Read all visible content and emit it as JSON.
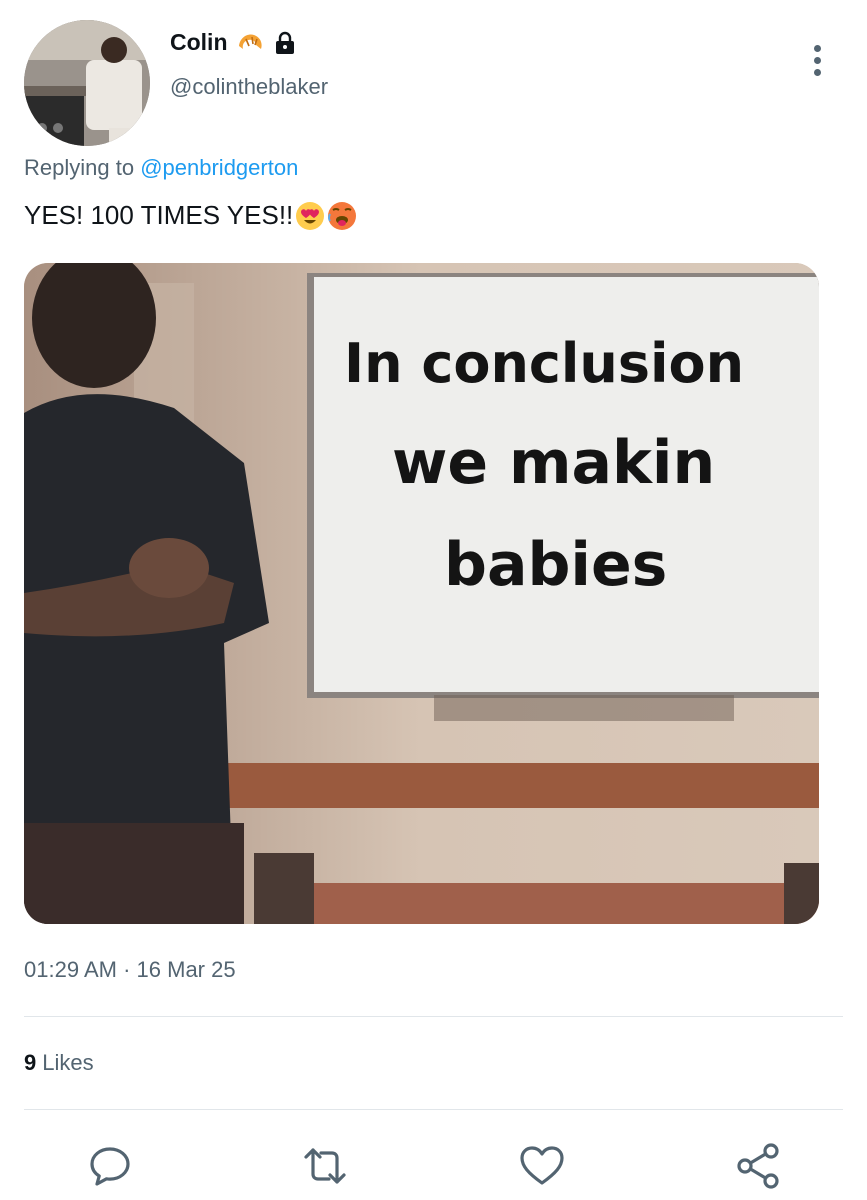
{
  "author": {
    "display_name": "Colin",
    "handle": "@colintheblaker",
    "badges": [
      "croissant-icon",
      "lock-icon"
    ]
  },
  "reply": {
    "prefix": "Replying to",
    "mention": "@penbridgerton"
  },
  "tweet": {
    "text": "YES! 100 TIMES YES!!",
    "emojis": [
      "heart-eyes-emoji",
      "hot-face-emoji"
    ]
  },
  "media": {
    "sign_lines": [
      "In conclusion",
      "we makin",
      "babies"
    ]
  },
  "meta": {
    "time": "01:29 AM",
    "separator": "·",
    "date": "16 Mar 25"
  },
  "stats": {
    "likes_count": "9",
    "likes_label": "Likes"
  },
  "actions": [
    "reply-icon",
    "retweet-icon",
    "like-icon",
    "share-icon"
  ],
  "colors": {
    "text_primary": "#0f1419",
    "text_secondary": "#536471",
    "link": "#1d9bf0",
    "divider": "#e1e6ea"
  }
}
